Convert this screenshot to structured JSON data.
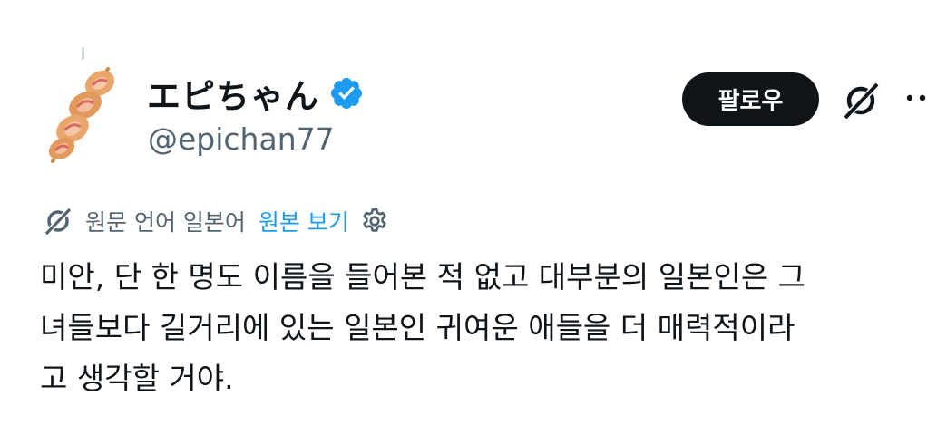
{
  "author": {
    "display_name": "エピちゃん",
    "handle": "@epichan77",
    "verified": true,
    "avatar_icon": "fried-food-skewer-icon"
  },
  "actions": {
    "follow_label": "팔로우",
    "grok_icon": "grok-icon",
    "more_icon": "more-dots-icon"
  },
  "translation": {
    "source_language_label": "원문 언어 일본어",
    "show_original_label": "원본 보기",
    "translate_icon": "translate-icon",
    "settings_icon": "gear-icon"
  },
  "tweet": {
    "lines": [
      "미안, 단 한 명도 이름을 들어본 적 없고 대부분의 일본인은 그",
      "녀들보다 길거리에 있는 일본인 귀여운 애들을 더 매력적이라",
      "고 생각할 거야."
    ]
  },
  "colors": {
    "text_primary": "#0f1419",
    "text_secondary": "#536471",
    "link": "#1d9bf0",
    "verified_badge": "#1d9bf0",
    "follow_button_bg": "#0f1419"
  }
}
